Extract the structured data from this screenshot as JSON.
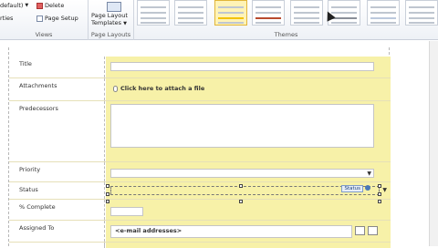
{
  "ribbon": {
    "views": {
      "default_label": "default)",
      "properties_label": "rties",
      "delete_label": "Delete",
      "page_setup_label": "Page Setup",
      "group_label": "Views"
    },
    "page_layouts": {
      "button_label_line1": "Page Layout",
      "button_label_line2": "Templates",
      "group_label": "Page Layouts"
    },
    "themes": {
      "group_label": "Themes",
      "swatches": [
        "plain",
        "plain",
        "yellow",
        "red",
        "plain",
        "grey",
        "blue",
        "plain"
      ],
      "selected_index": 2
    }
  },
  "form": {
    "fields": {
      "title": "Title",
      "attachments": "Attachments",
      "attach_link": "Click here to attach a file",
      "predecessors": "Predecessors",
      "priority": "Priority",
      "status": "Status",
      "status_badge": "Status",
      "percent_complete": "% Complete",
      "assigned_to": "Assigned To",
      "email_placeholder": "<e-mail addresses>"
    }
  },
  "colors": {
    "control_bg": "#f7f1a8",
    "accent": "#f2c200"
  }
}
